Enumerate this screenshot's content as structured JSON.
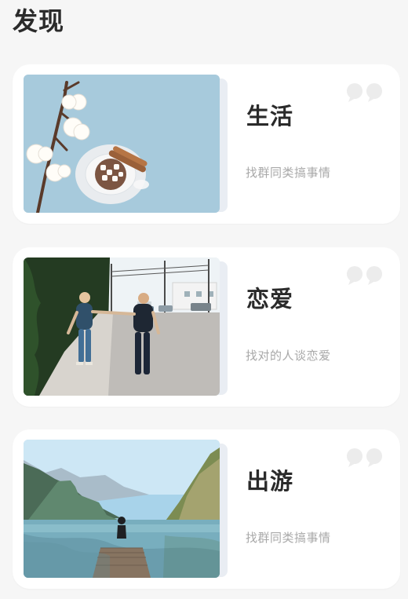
{
  "page": {
    "title": "发现"
  },
  "cards": [
    {
      "title": "生活",
      "subtitle": "找群同类搞事情",
      "image": "cotton-cocoa-photo"
    },
    {
      "title": "恋爱",
      "subtitle": "找对的人谈恋爱",
      "image": "couple-walking-photo"
    },
    {
      "title": "出游",
      "subtitle": "找群同类搞事情",
      "image": "lake-mountains-photo"
    }
  ],
  "icons": {
    "quote": "quote-icon"
  },
  "colors": {
    "background": "#f6f6f6",
    "card": "#ffffff",
    "title": "#2a2a2a",
    "subtitle": "#a8a8a8",
    "quote": "#ececec"
  }
}
